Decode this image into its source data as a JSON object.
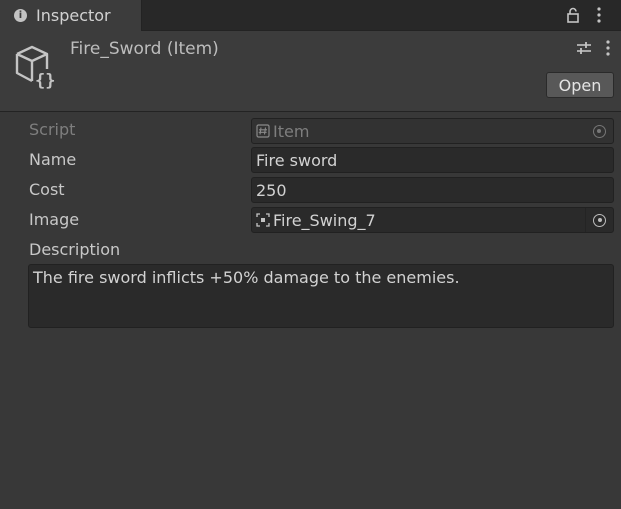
{
  "tab": {
    "label": "Inspector",
    "icon": "info-icon"
  },
  "header": {
    "title": "Fire_Sword (Item)",
    "icon": "scriptable-object-icon",
    "open_label": "Open"
  },
  "fields": {
    "script": {
      "label": "Script",
      "value": "Item",
      "icon": "script-icon"
    },
    "name": {
      "label": "Name",
      "value": "Fire sword"
    },
    "cost": {
      "label": "Cost",
      "value": "250"
    },
    "image": {
      "label": "Image",
      "value": "Fire_Swing_7",
      "icon": "sprite-icon"
    },
    "description": {
      "label": "Description",
      "value": "The fire sword inflicts +50% damage to the enemies."
    }
  },
  "colors": {
    "background": "#383838",
    "field": "#2a2a2a",
    "text": "#c8c8c8"
  }
}
